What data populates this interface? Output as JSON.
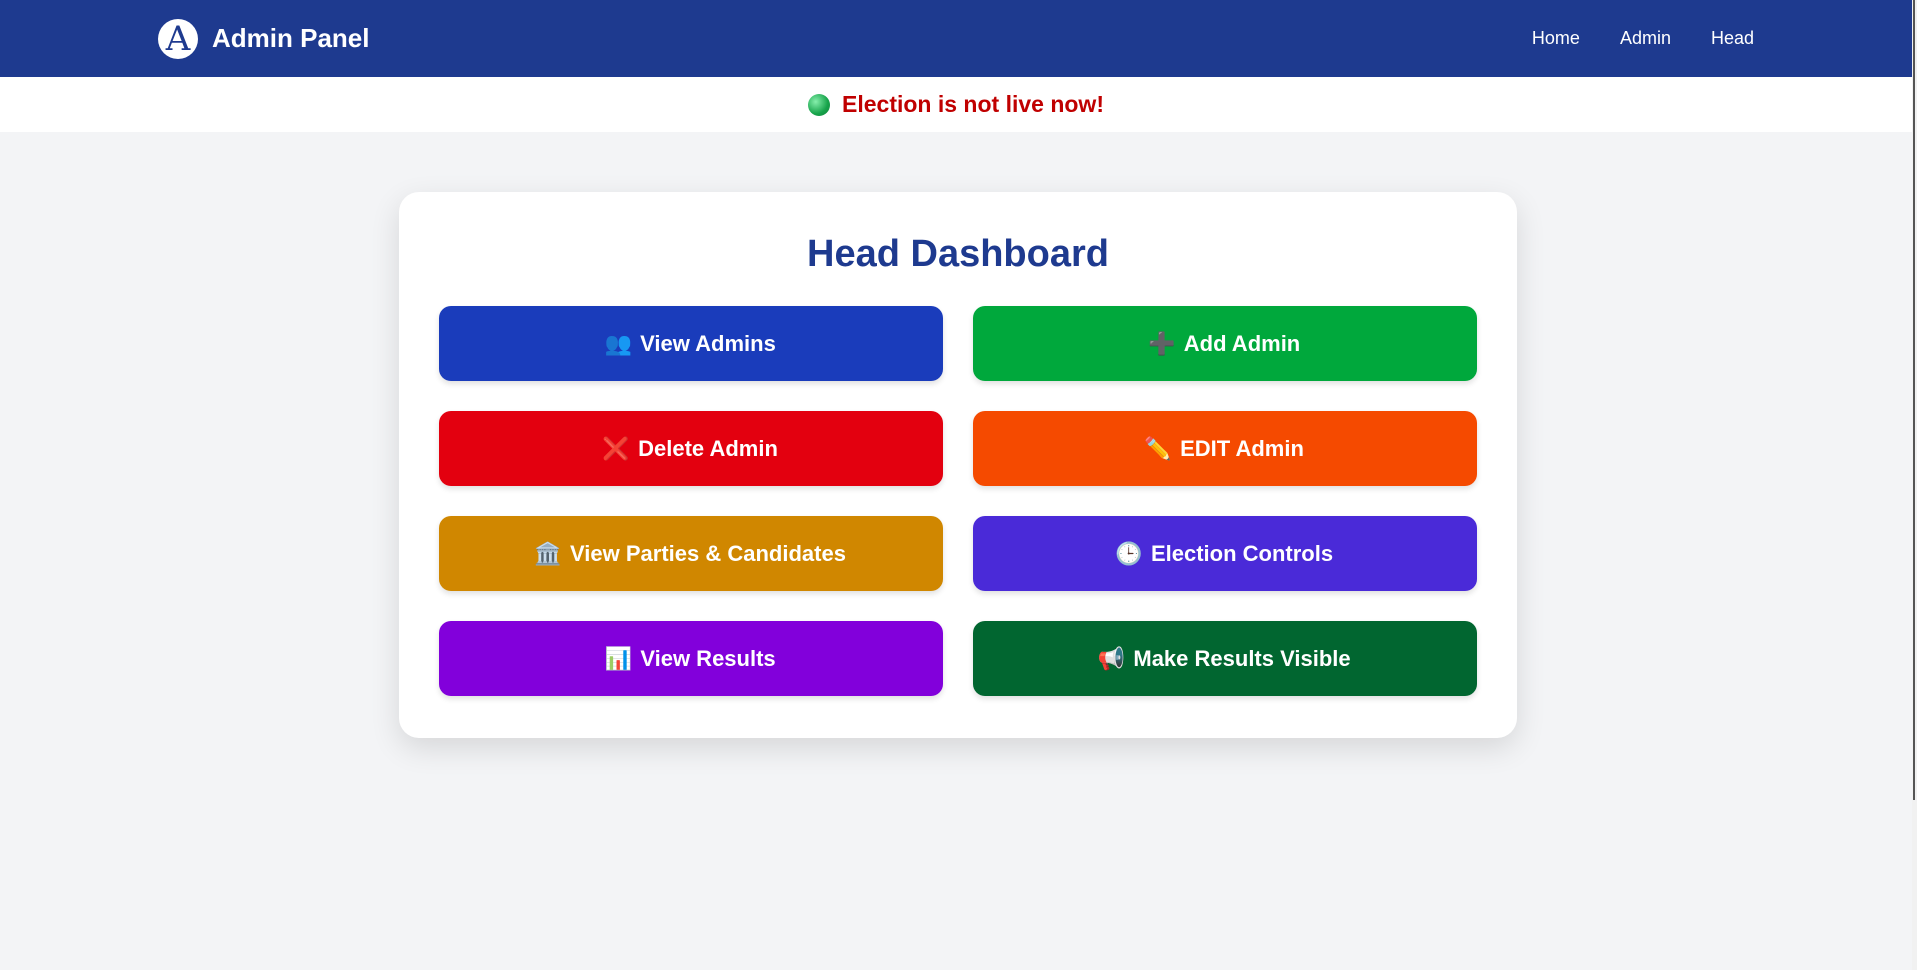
{
  "navbar": {
    "logo_letter": "A",
    "title": "Admin Panel",
    "links": [
      {
        "label": "Home"
      },
      {
        "label": "Admin"
      },
      {
        "label": "Head"
      }
    ]
  },
  "status": {
    "text": "Election is not live now!",
    "dot_color": "#22c55e",
    "text_color": "#c00000"
  },
  "dashboard": {
    "title": "Head Dashboard",
    "buttons": [
      {
        "label": "View Admins",
        "icon": "users-icon",
        "glyph": "👥",
        "color": "#1a3cbb"
      },
      {
        "label": "Add Admin",
        "icon": "plus-icon",
        "glyph": "➕",
        "color": "#00a83c"
      },
      {
        "label": "Delete Admin",
        "icon": "cross-icon",
        "glyph": "❌",
        "color": "#e3000f"
      },
      {
        "label": "EDIT Admin",
        "icon": "pencil-icon",
        "glyph": "✏️",
        "color": "#f54a00"
      },
      {
        "label": "View Parties & Candidates",
        "icon": "building-icon",
        "glyph": "🏛️",
        "color": "#d08700"
      },
      {
        "label": "Election Controls",
        "icon": "clock-icon",
        "glyph": "🕒",
        "color": "#4a2ad8"
      },
      {
        "label": "View Results",
        "icon": "bar-chart-icon",
        "glyph": "📊",
        "color": "#8200db"
      },
      {
        "label": "Make Results Visible",
        "icon": "megaphone-icon",
        "glyph": "📢",
        "color": "#016630"
      }
    ]
  }
}
